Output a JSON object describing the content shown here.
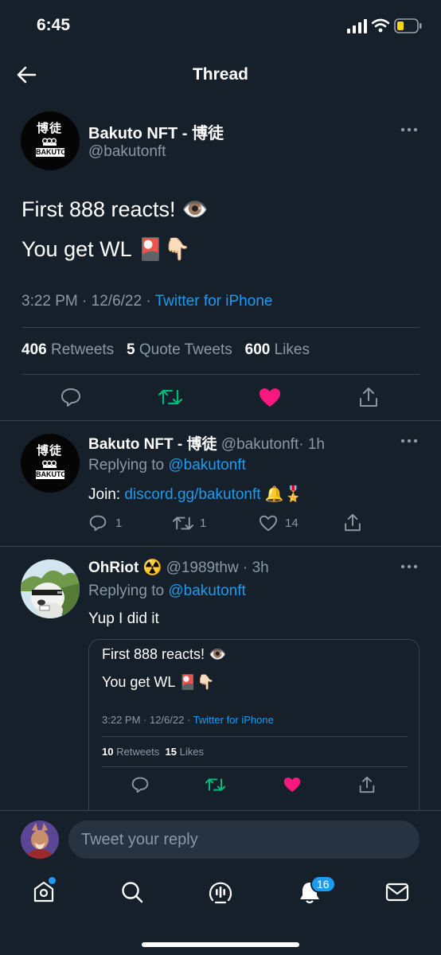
{
  "status_bar": {
    "time": "6:45"
  },
  "header": {
    "title": "Thread"
  },
  "main_tweet": {
    "display_name": "Bakuto NFT - 博徒",
    "handle": "@bakutonft",
    "line1": "First 888 reacts! 👁️",
    "line2": "You get WL 🎴👇🏻",
    "time": "3:22 PM",
    "date": "12/6/22",
    "source": "Twitter for iPhone",
    "retweets_count": "406",
    "retweets_label": "Retweets",
    "quotes_count": "5",
    "quotes_label": "Quote Tweets",
    "likes_count": "600",
    "likes_label": "Likes"
  },
  "reply1": {
    "display_name": "Bakuto NFT - 博徒",
    "handle": "@bakutonft",
    "age": "· 1h",
    "replying_prefix": "Replying to",
    "replying_handle": "@bakutonft",
    "text_prefix": "Join:",
    "text_link": "discord.gg/bakutonft",
    "text_suffix": "🔔🎖️",
    "reply_count": "1",
    "retweet_count": "1",
    "like_count": "14"
  },
  "reply2": {
    "display_name": "OhRiot",
    "badge": "☢️",
    "handle": "@1989thw",
    "age": "· 3h",
    "replying_prefix": "Replying to",
    "replying_handle": "@bakutonft",
    "text": "Yup I did it",
    "quoted": {
      "line1": "First 888 reacts! 👁️",
      "line2": "You get WL 🎴👇🏻",
      "meta": "3:22 PM · 12/6/22 ·",
      "source": "Twitter for iPhone",
      "retweets_count": "10",
      "retweets_label": "Retweets",
      "likes_count": "15",
      "likes_label": "Likes"
    }
  },
  "reply_bar": {
    "placeholder": "Tweet your reply"
  },
  "tab_bar": {
    "notifications_badge": "16"
  },
  "avatar_logo": {
    "kanji": "博徒",
    "word": "BAKUTO"
  },
  "colors": {
    "background": "#15202b",
    "accent": "#1d9bf0",
    "retweet": "#00ba7c",
    "like": "#f91880",
    "muted": "#8b98a5",
    "divider": "#38444d"
  }
}
